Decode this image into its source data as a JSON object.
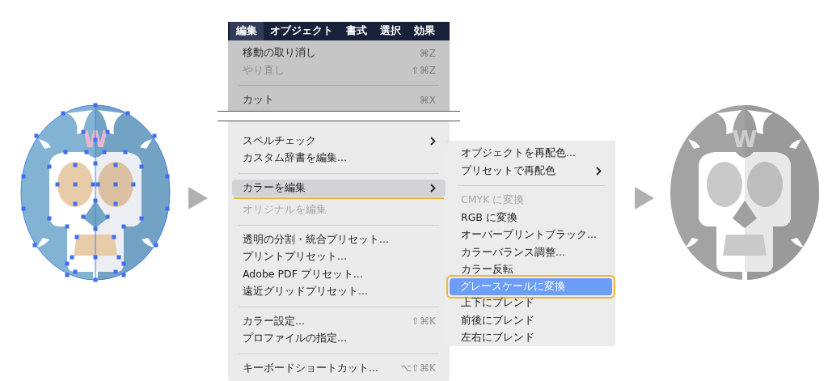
{
  "before_artwork": {
    "emblem": "W",
    "grayscale": false,
    "anchors_shown": true
  },
  "menu_bar": [
    {
      "label": "編集",
      "selected": true
    },
    {
      "label": "オブジェクト",
      "selected": false
    },
    {
      "label": "書式",
      "selected": false
    },
    {
      "label": "選択",
      "selected": false
    },
    {
      "label": "効果",
      "selected": false
    }
  ],
  "edit_menu": {
    "sections": [
      {
        "dimmed": true,
        "items": [
          {
            "kind": "item",
            "label": "移動の取り消し",
            "shortcut": "⌘Z",
            "disabled": false,
            "has_submenu": false,
            "selected": false
          },
          {
            "kind": "item",
            "label": "やり直し",
            "shortcut": "⇧⌘Z",
            "disabled": true,
            "has_submenu": false,
            "selected": false
          },
          {
            "kind": "separator"
          },
          {
            "kind": "item",
            "label": "カット",
            "shortcut": "⌘X",
            "disabled": false,
            "has_submenu": false,
            "selected": false
          }
        ]
      },
      {
        "dimmed": false,
        "items": [
          {
            "kind": "item",
            "label": "スペルチェック",
            "disabled": false,
            "has_submenu": true,
            "selected": false
          },
          {
            "kind": "item",
            "label": "カスタム辞書を編集...",
            "disabled": false,
            "has_submenu": false,
            "selected": false
          },
          {
            "kind": "separator"
          },
          {
            "kind": "item",
            "label": "カラーを編集",
            "disabled": false,
            "has_submenu": true,
            "selected": true,
            "underlined": true
          },
          {
            "kind": "item",
            "label": "オリジナルを編集",
            "disabled": true,
            "has_submenu": false,
            "selected": false
          },
          {
            "kind": "separator"
          },
          {
            "kind": "item",
            "label": "透明の分割・統合プリセット...",
            "disabled": false,
            "has_submenu": false,
            "selected": false
          },
          {
            "kind": "item",
            "label": "プリントプリセット...",
            "disabled": false,
            "has_submenu": false,
            "selected": false
          },
          {
            "kind": "item",
            "label": "Adobe PDF プリセット...",
            "disabled": false,
            "has_submenu": false,
            "selected": false
          },
          {
            "kind": "item",
            "label": "遠近グリッドプリセット...",
            "disabled": false,
            "has_submenu": false,
            "selected": false
          },
          {
            "kind": "separator"
          },
          {
            "kind": "item",
            "label": "カラー設定...",
            "shortcut": "⇧⌘K",
            "disabled": false,
            "has_submenu": false,
            "selected": false
          },
          {
            "kind": "item",
            "label": "プロファイルの指定...",
            "disabled": false,
            "has_submenu": false,
            "selected": false
          },
          {
            "kind": "separator"
          },
          {
            "kind": "item",
            "label": "キーボードショートカット...",
            "shortcut": "⌥⇧⌘K",
            "disabled": false,
            "has_submenu": false,
            "selected": false
          }
        ]
      }
    ]
  },
  "color_submenu": [
    {
      "kind": "item",
      "label": "オブジェクトを再配色...",
      "disabled": false,
      "has_submenu": false,
      "selected": false
    },
    {
      "kind": "item",
      "label": "プリセットで再配色",
      "disabled": false,
      "has_submenu": true,
      "selected": false
    },
    {
      "kind": "separator"
    },
    {
      "kind": "item",
      "label": "CMYK に変換",
      "disabled": true,
      "has_submenu": false,
      "selected": false
    },
    {
      "kind": "item",
      "label": "RGB に変換",
      "disabled": false,
      "has_submenu": false,
      "selected": false
    },
    {
      "kind": "item",
      "label": "オーバープリントブラック...",
      "disabled": false,
      "has_submenu": false,
      "selected": false
    },
    {
      "kind": "item",
      "label": "カラーバランス調整...",
      "disabled": false,
      "has_submenu": false,
      "selected": false
    },
    {
      "kind": "item",
      "label": "カラー反転",
      "disabled": false,
      "has_submenu": false,
      "selected": false
    },
    {
      "kind": "item",
      "label": "グレースケールに変換",
      "disabled": false,
      "has_submenu": false,
      "selected": true,
      "framed": true
    },
    {
      "kind": "item",
      "label": "上下にブレンド",
      "disabled": false,
      "has_submenu": false,
      "selected": false
    },
    {
      "kind": "item",
      "label": "前後にブレンド",
      "disabled": false,
      "has_submenu": false,
      "selected": false
    },
    {
      "kind": "item",
      "label": "左右にブレンド",
      "disabled": false,
      "has_submenu": false,
      "selected": false
    }
  ],
  "after_artwork": {
    "emblem": "W",
    "grayscale": true
  }
}
